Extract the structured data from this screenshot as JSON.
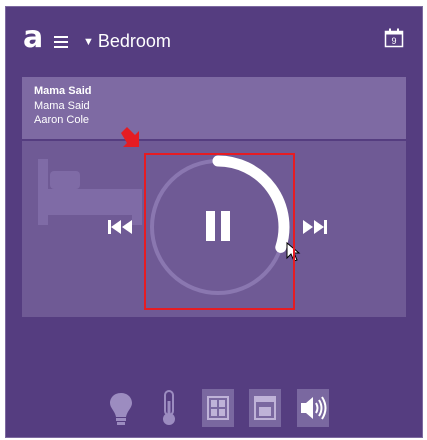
{
  "app": {
    "logo_text": "a",
    "room": "Bedroom",
    "calendar_day": "9"
  },
  "now_playing": {
    "title": "Mama Said",
    "album": "Mama Said",
    "artist": "Aaron Cole"
  },
  "player": {
    "state": "playing",
    "volume_level": 0.3,
    "icons": {
      "previous": "skip-previous-icon",
      "pause": "pause-icon",
      "next": "skip-next-icon",
      "room": "bed-icon"
    }
  },
  "bottom_nav": [
    {
      "name": "lighting",
      "icon": "lightbulb-icon"
    },
    {
      "name": "climate",
      "icon": "thermometer-icon"
    },
    {
      "name": "windows",
      "icon": "window-icon"
    },
    {
      "name": "shades",
      "icon": "shades-icon"
    },
    {
      "name": "audio",
      "icon": "speaker-icon",
      "active": true
    }
  ],
  "colors": {
    "background": "#553d80",
    "panel": "#6f5a95",
    "strip": "#7e6aa3",
    "annotation": "#e51c23"
  }
}
